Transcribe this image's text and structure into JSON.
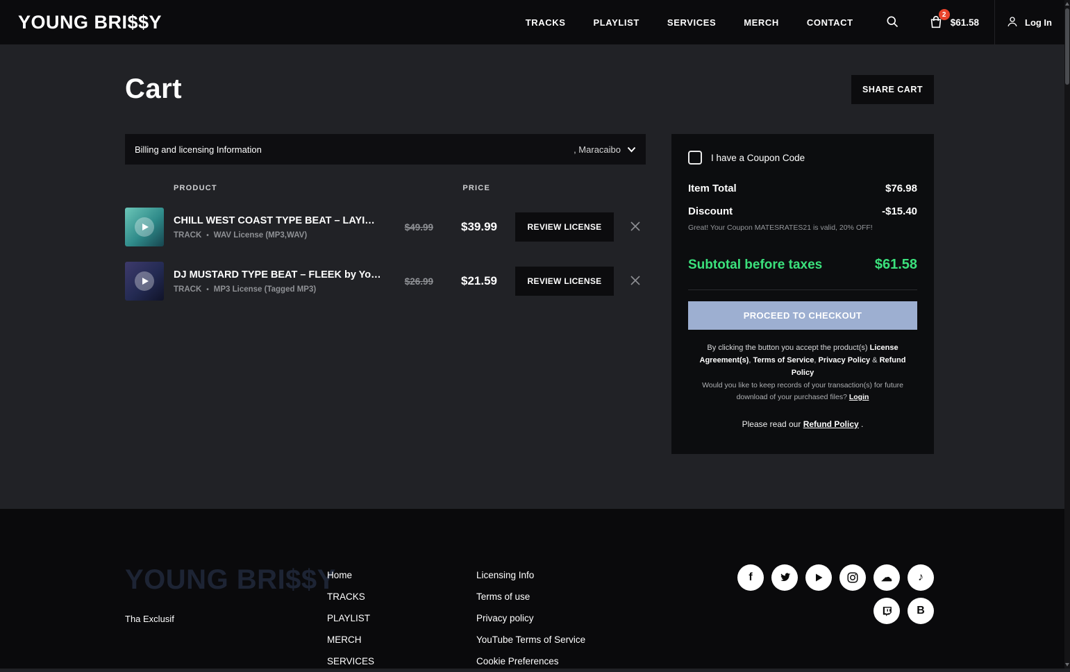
{
  "header": {
    "logo": "YOUNG BRI$$Y",
    "nav": {
      "tracks": "TRACKS",
      "playlist": "PLAYLIST",
      "services": "SERVICES",
      "merch": "MERCH",
      "contact": "CONTACT"
    },
    "cart": {
      "badge": "2",
      "total": "$61.58"
    },
    "login": "Log In"
  },
  "cart": {
    "title": "Cart",
    "share_button": "SHARE CART",
    "billing": {
      "label": "Billing and licensing Information",
      "selected": ", Maracaibo"
    },
    "columns": {
      "product": "PRODUCT",
      "price": "PRICE"
    },
    "items": [
      {
        "title": "CHILL WEST COAST TYPE BEAT – LAYIN LOW by You...",
        "type": "TRACK",
        "license": "WAV License (MP3,WAV)",
        "old_price": "$49.99",
        "price": "$39.99",
        "review_button": "REVIEW LICENSE"
      },
      {
        "title": "DJ MUSTARD TYPE BEAT – FLEEK by Young Bri$$y",
        "type": "TRACK",
        "license": "MP3 License (Tagged MP3)",
        "old_price": "$26.99",
        "price": "$21.59",
        "review_button": "REVIEW LICENSE"
      }
    ]
  },
  "summary": {
    "coupon_checkbox_label": "I have a Coupon Code",
    "item_total_label": "Item Total",
    "item_total_value": "$76.98",
    "discount_label": "Discount",
    "discount_value": "-$15.40",
    "coupon_message": "Great! Your Coupon MATESRATES21 is valid, 20% OFF!",
    "subtotal_label": "Subtotal before taxes",
    "subtotal_value": "$61.58",
    "checkout_button": "PROCEED TO CHECKOUT",
    "legal": {
      "part1": "By clicking the button you accept the product(s) ",
      "bold1": "License Agreement(s)",
      "part2": ", ",
      "bold2": "Terms of Service",
      "part3": ", ",
      "bold3": "Privacy Policy",
      "part4": " & ",
      "bold4": "Refund Policy"
    },
    "records_text": "Would you like to keep records of your transaction(s) for future download of your purchased files? ",
    "records_link": "Login",
    "refund_text": "Please read our ",
    "refund_link": "Refund Policy",
    "refund_suffix": " ."
  },
  "footer": {
    "brand": "YOUNG BRI$$Y",
    "tagline": "Tha Exclusif",
    "nav_links": [
      "Home",
      "TRACKS",
      "PLAYLIST",
      "MERCH",
      "SERVICES"
    ],
    "legal_links": [
      "Licensing Info",
      "Terms of use",
      "Privacy policy",
      "YouTube Terms of Service",
      "Cookie Preferences"
    ],
    "social": [
      {
        "name": "facebook",
        "glyph": "f"
      },
      {
        "name": "twitter",
        "glyph": ""
      },
      {
        "name": "youtube",
        "glyph": ""
      },
      {
        "name": "instagram",
        "glyph": ""
      },
      {
        "name": "soundcloud",
        "glyph": "☁"
      },
      {
        "name": "tiktok",
        "glyph": "♪"
      },
      {
        "name": "twitch",
        "glyph": ""
      },
      {
        "name": "bandlab",
        "glyph": "B"
      }
    ]
  },
  "colors": {
    "accent_green": "#3be17c",
    "checkout_button": "#9dafd1",
    "badge_red": "#e8442c",
    "header_bg": "#0b0b0d",
    "page_bg": "#212226",
    "card_bg": "#0c0d0f"
  }
}
